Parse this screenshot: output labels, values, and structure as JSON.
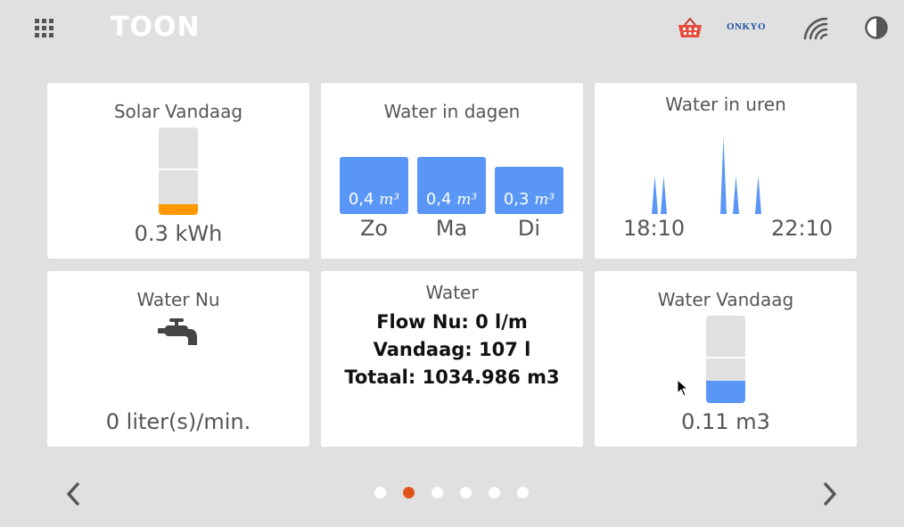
{
  "header": {
    "logo": "TOON",
    "brand_partner": "ONKYO",
    "icons": [
      "apps-grid-icon",
      "basket-icon",
      "wifi-icon",
      "contrast-icon"
    ]
  },
  "tiles": {
    "solar": {
      "title": "Solar Vandaag",
      "value": "0.3 kWh",
      "level": 0.12,
      "color": "#ff9800"
    },
    "water_days": {
      "title": "Water in dagen",
      "days": [
        {
          "label": "Zo",
          "value": "0,4",
          "unit": "m³",
          "amount": 0.4
        },
        {
          "label": "Ma",
          "value": "0,4",
          "unit": "m³",
          "amount": 0.4
        },
        {
          "label": "Di",
          "value": "0,3",
          "unit": "m³",
          "amount": 0.3
        }
      ],
      "bar_color": "#5a96f5"
    },
    "water_hours": {
      "title": "Water in uren",
      "start_time": "18:10",
      "end_time": "22:10"
    },
    "water_now": {
      "title": "Water Nu",
      "value": "0 liter(s)/min."
    },
    "water": {
      "title": "Water",
      "flow": "Flow Nu: 0 l/m",
      "today": "Vandaag: 107 l",
      "total": "Totaal: 1034.986 m3"
    },
    "water_today": {
      "title": "Water Vandaag",
      "value": "0.11 m3",
      "level": 0.25,
      "color": "#5a96f5"
    }
  },
  "pagination": {
    "pages": 6,
    "current": 2,
    "active_color": "#e0531b"
  }
}
